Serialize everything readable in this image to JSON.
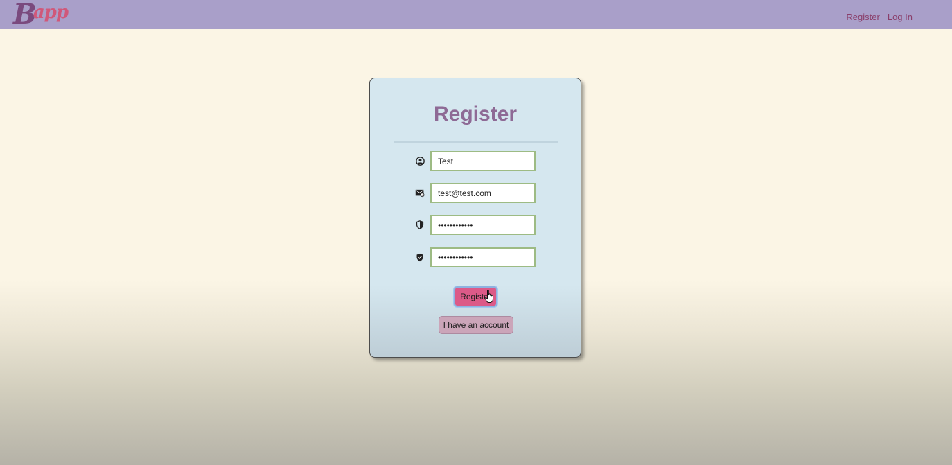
{
  "nav": {
    "logo_main": "B",
    "logo_rest": "app",
    "links": [
      "Register",
      "Log In"
    ]
  },
  "form": {
    "title": "Register",
    "fields": [
      {
        "icon": "user-circle-icon",
        "value": "Test",
        "type": "text"
      },
      {
        "icon": "envelope-icon",
        "value": "test@test.com",
        "type": "email"
      },
      {
        "icon": "shield-icon",
        "value": "testpassword",
        "type": "password"
      },
      {
        "icon": "shield-check-icon",
        "value": "testpassword",
        "type": "password"
      }
    ],
    "submit_label": "Register",
    "secondary_label": "I have an account"
  },
  "colors": {
    "navbar": "#a99fc9",
    "card_bg": "#d5e7ef",
    "title": "#8e6a95",
    "input_border": "#9dbb84",
    "submit_bg": "#dc5a88",
    "secondary_bg": "#cba5b9"
  }
}
